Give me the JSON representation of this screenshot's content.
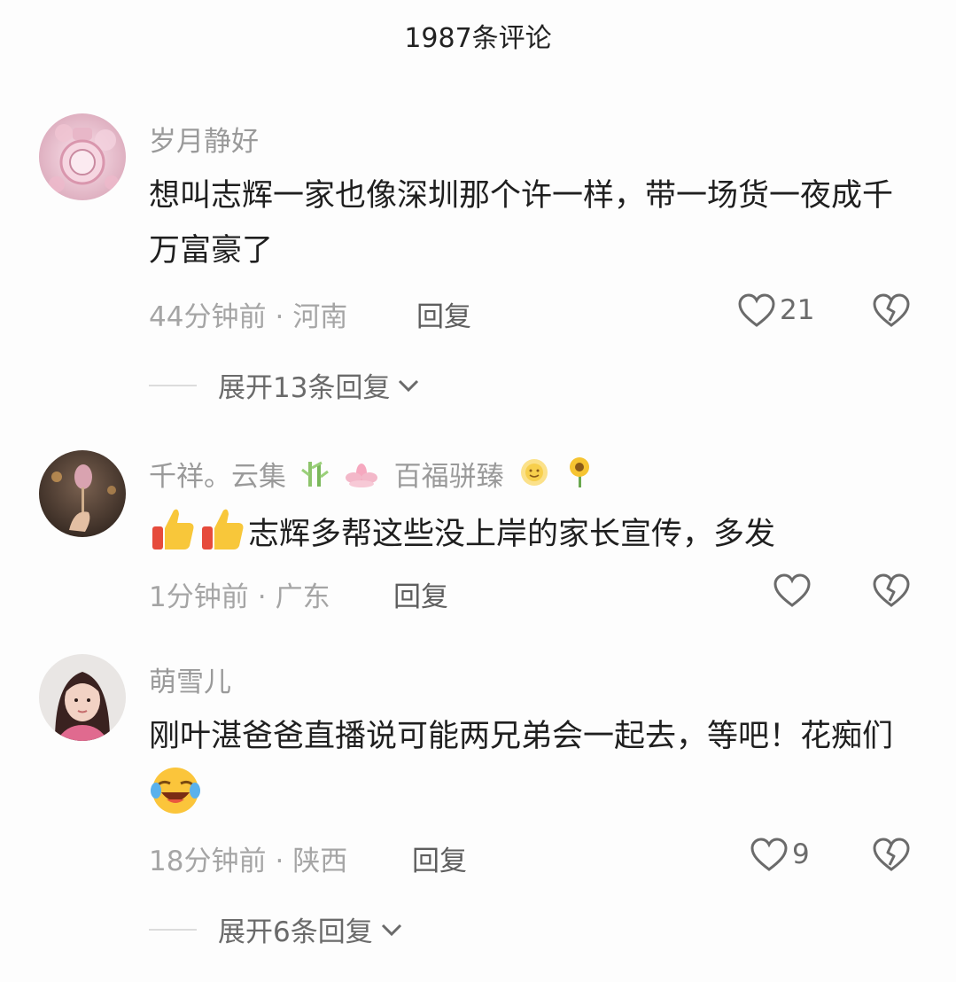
{
  "header": {
    "title": "1987条评论"
  },
  "comments": [
    {
      "username": "岁月静好",
      "text": "想叫志辉一家也像深圳那个许一样，带一场货一夜成千万富豪了",
      "time": "44分钟前",
      "location": "河南",
      "reply_label": "回复",
      "likes": "21",
      "expand_label": "展开13条回复"
    },
    {
      "username": "千祥。云集",
      "username_suffix": "百福骈臻",
      "text": "志辉多帮这些没上岸的家长宣传，多发",
      "time": "1分钟前",
      "location": "广东",
      "reply_label": "回复"
    },
    {
      "username": "萌雪儿",
      "text": "刚叶湛爸爸直播说可能两兄弟会一起去，等吧！花痴们",
      "time": "18分钟前",
      "location": "陕西",
      "reply_label": "回复",
      "likes": "9",
      "expand_label": "展开6条回复"
    }
  ],
  "icons": {
    "like": "heart-outline-icon",
    "dislike": "broken-heart-icon",
    "expand": "chevron-down-icon"
  }
}
